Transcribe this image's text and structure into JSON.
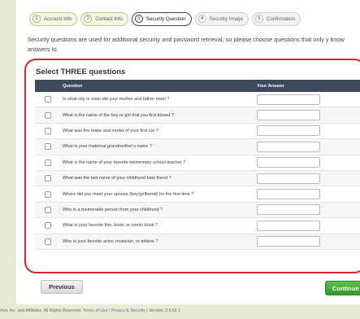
{
  "steps": [
    {
      "num": "1",
      "label": "Account Info",
      "state": "done"
    },
    {
      "num": "2",
      "label": "Contact Info",
      "state": "done"
    },
    {
      "num": "3",
      "label": "Security Question",
      "state": "active"
    },
    {
      "num": "4",
      "label": "Security Image",
      "state": "todo"
    },
    {
      "num": "5",
      "label": "Confirmation",
      "state": "todo"
    }
  ],
  "intro": "Security questions are used for additional security and password retrieval, so please choose questions that only y know answers to.",
  "section_title": "Select THREE questions",
  "table": {
    "col_question": "Question",
    "col_answer": "Your Answer",
    "rows": [
      {
        "question": "In what city or town did your mother and father meet ?",
        "answer": ""
      },
      {
        "question": "What is the name of the boy or girl that you first kissed ?",
        "answer": ""
      },
      {
        "question": "What was the make and model of your first car ?",
        "answer": ""
      },
      {
        "question": "What is your maternal grandmother's name ?",
        "answer": ""
      },
      {
        "question": "What is the name of your favorite elementary school teacher ?",
        "answer": ""
      },
      {
        "question": "What was the last name of your childhood best friend ?",
        "answer": ""
      },
      {
        "question": "Where did you meet your spouse (boy/girlfriend) for the first time ?",
        "answer": ""
      },
      {
        "question": "Who is a memorable person from your childhood ?",
        "answer": ""
      },
      {
        "question": "What is your favorite film, book, or comic book ?",
        "answer": ""
      },
      {
        "question": "Who is your favorite actor, musician, or athlete ?",
        "answer": ""
      }
    ]
  },
  "buttons": {
    "previous": "Previous",
    "continue": "Continue"
  },
  "footer": {
    "prefix": "rhet, Inc. and Affiliates. All Rights Reserved.",
    "terms": "Terms of Use",
    "sep": "|",
    "privacy": "Privacy & Security",
    "version": "| Version: 2.5.62.1"
  },
  "colors": {
    "highlight_border": "#d8232a",
    "header_bg": "#3d4a5c",
    "continue_bg": "#3aa534"
  }
}
